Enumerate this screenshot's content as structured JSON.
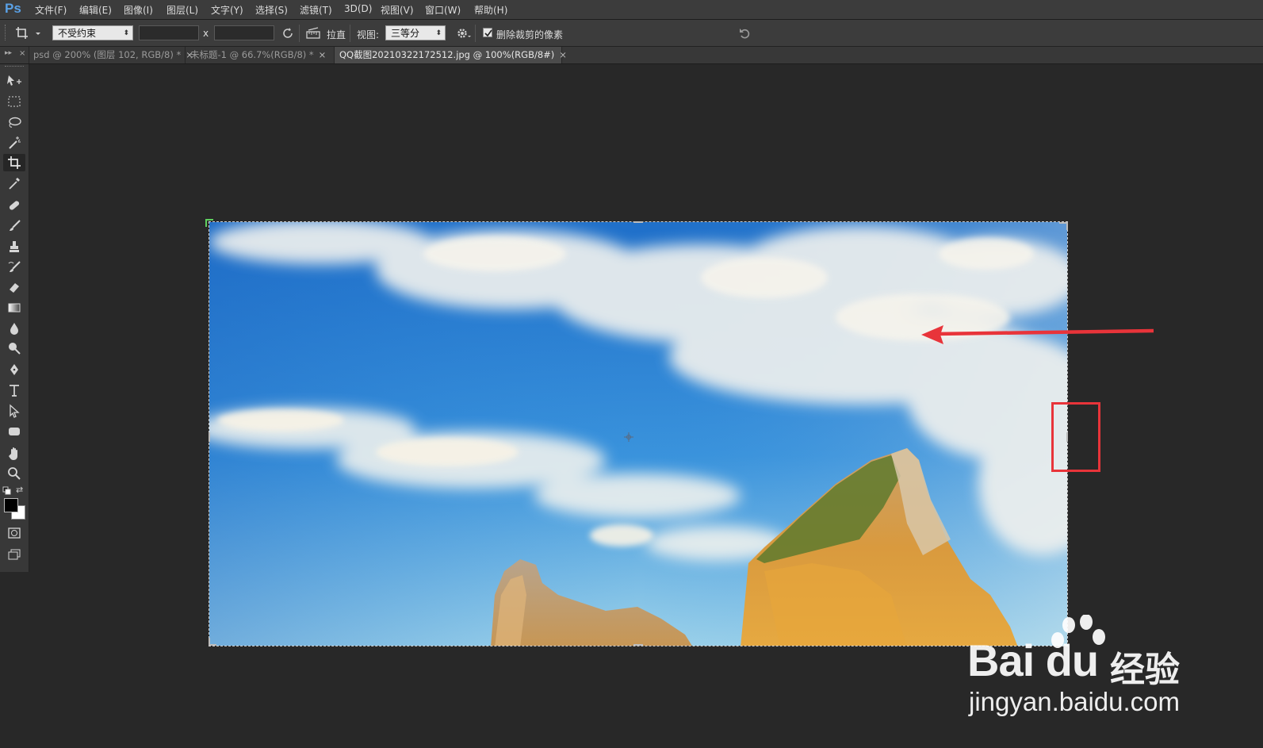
{
  "app": {
    "logo": "Ps"
  },
  "menu": [
    "文件(F)",
    "编辑(E)",
    "图像(I)",
    "图层(L)",
    "文字(Y)",
    "选择(S)",
    "滤镜(T)",
    "3D(D)",
    "视图(V)",
    "窗口(W)",
    "帮助(H)"
  ],
  "options": {
    "ratio_select": "不受约束",
    "times_sign": "x",
    "straighten_label": "拉直",
    "view_label": "视图:",
    "view_select": "三等分",
    "delete_pixels_label": "删除裁剪的像素",
    "delete_pixels_checked": true
  },
  "tabs": [
    {
      "label": "psd @ 200% (图层 102, RGB/8) *",
      "close": "×",
      "active": false
    },
    {
      "label": "未标题-1 @ 66.7%(RGB/8) *",
      "close": "×",
      "active": false
    },
    {
      "label": "QQ截图20210322172512.jpg @ 100%(RGB/8#)",
      "close": "×",
      "active": true
    }
  ],
  "tools": [
    "move-tool-icon",
    "marquee-tool-icon",
    "lasso-tool-icon",
    "magic-wand-icon",
    "crop-tool-icon",
    "eyedropper-icon",
    "healing-brush-icon",
    "brush-icon",
    "clone-stamp-icon",
    "history-brush-icon",
    "eraser-icon",
    "gradient-icon",
    "blur-icon",
    "dodge-icon",
    "pen-icon",
    "type-icon",
    "path-selection-icon",
    "shape-icon",
    "hand-icon",
    "zoom-icon"
  ],
  "colors": {
    "foreground": "#000000",
    "background": "#ffffff",
    "annotation": "#e8343a"
  },
  "watermark": {
    "brand": "Bai du",
    "cn": "经验",
    "url": "jingyan.baidu.com"
  }
}
